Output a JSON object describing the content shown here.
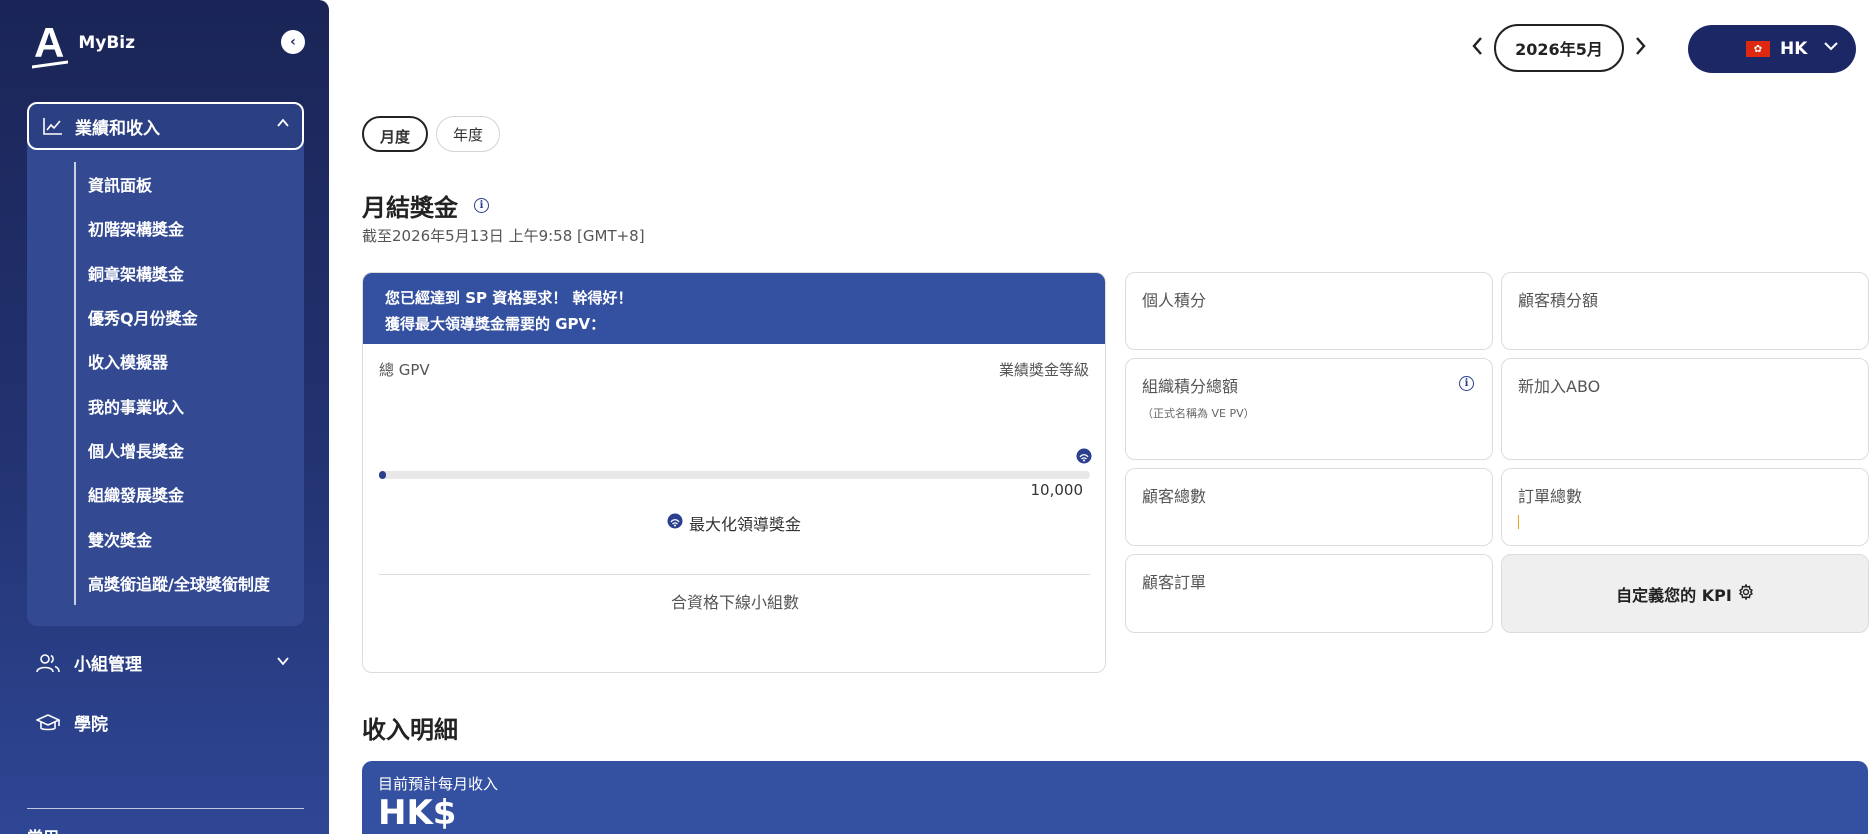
{
  "brand": {
    "logo_letter": "A",
    "name": "MyBiz"
  },
  "sidebar": {
    "group": {
      "label": "業績和收入",
      "items": [
        {
          "label": "資訊面板"
        },
        {
          "label": "初階架構獎金"
        },
        {
          "label": "銅章架構獎金"
        },
        {
          "label": "優秀Q月份獎金"
        },
        {
          "label": "收入模擬器"
        },
        {
          "label": "我的事業收入"
        },
        {
          "label": "個人增長獎金"
        },
        {
          "label": "組織發展獎金"
        },
        {
          "label": "雙次獎金"
        },
        {
          "label": "高獎銜追蹤/全球獎銜制度"
        }
      ]
    },
    "team_label": "小組管理",
    "academy_label": "學院",
    "footer_label": "常用"
  },
  "header": {
    "date": "2026年5月",
    "region": "HK"
  },
  "tabs": [
    {
      "label": "月度"
    },
    {
      "label": "年度"
    }
  ],
  "monthly": {
    "title": "月結獎金",
    "timestamp": "截至2026年5月13日 上午9:58 [GMT+8]",
    "banner_line1": "您已經達到 SP 資格要求！ 幹得好！",
    "banner_line2": "獲得最大領導獎金需要的 GPV：",
    "total_gpv_label": "總 GPV",
    "level_label": "業績獎金等級",
    "target_value": "10,000",
    "progress_fraction": 0.01,
    "max_bonus_label": "最大化領導獎金",
    "qualified_label": "合資格下線小組數"
  },
  "kpis": {
    "personal_points": "個人積分",
    "customer_points": "顧客積分額",
    "org_points": "組織積分總額",
    "org_points_note": "（正式名稱為 VE PV）",
    "new_abo": "新加入ABO",
    "customer_count": "顧客總數",
    "order_count": "訂單總數",
    "customer_orders": "顧客訂單",
    "custom_kpi": "自定義您的 KPI"
  },
  "income": {
    "title": "收入明細",
    "monthly_label": "目前預計每月收入",
    "currency": "HK$"
  },
  "colors": {
    "navy": "#1c2766",
    "brand_blue": "#3450a1",
    "accent": "#2b3f8f"
  }
}
